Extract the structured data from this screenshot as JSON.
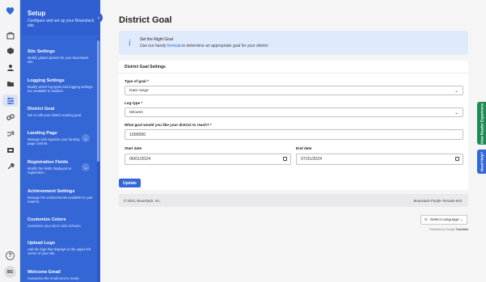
{
  "rail": {
    "logo": "heart-logo",
    "icons": [
      "library-icon",
      "box-icon",
      "user-icon",
      "folder-icon",
      "settings-icon",
      "link-icon",
      "shuffle-icon",
      "monitor-icon",
      "wrench-icon"
    ],
    "help": "?",
    "avatar": "BS"
  },
  "setup": {
    "title": "Setup",
    "description": "Configure and set up your Beanstack site.",
    "collapse": "‹",
    "items": [
      {
        "title": "Site Settings",
        "desc": "Modify global options for your Beanstack site."
      },
      {
        "title": "Logging Settings",
        "desc": "Modify which log types and logging settings are available to readers."
      },
      {
        "title": "District Goal",
        "desc": "Set or edit your district reading goal."
      },
      {
        "title": "Landing Page",
        "desc": "Manage and organize your landing page content."
      },
      {
        "title": "Registration Fields",
        "desc": "Modify the fields displayed at registration."
      },
      {
        "title": "Achievement Settings",
        "desc": "Manage the achievements available to your readers."
      },
      {
        "title": "Customize Colors",
        "desc": "Customize your site's color scheme."
      },
      {
        "title": "Upload Logo",
        "desc": "Add the logo that displays in the upper left corner of your site."
      },
      {
        "title": "Welcome Email",
        "desc": "Customize the email sent to newly"
      }
    ]
  },
  "main": {
    "title": "District Goal",
    "info": {
      "icon": "i",
      "title": "Set the Right Goal",
      "desc_before": "Use our handy ",
      "link": "formula",
      "desc_after": " to determine an appropriate goal for your district"
    },
    "card_title": "District Goal Settings",
    "goal_type_label": "Type of goal *",
    "goal_type_value": "Date range",
    "log_type_label": "Log type *",
    "log_type_value": "Minutes",
    "goal_label": "What goal would you like your district to reach? *",
    "goal_value": "1000000",
    "start_label": "Start date",
    "start_value": "06/01/2024",
    "end_label": "End date",
    "end_value": "07/31/2024",
    "update": "Update"
  },
  "footer": {
    "copyright": "© 2024, Beanstack, Inc.",
    "build": "Beanstack-Purple-Tornado-643"
  },
  "translate": {
    "g": "G",
    "label": "Select Language",
    "caret": "⌄",
    "powered_by": "Powered by",
    "google": "Google",
    "translate": "Translate"
  },
  "tabs": {
    "reader_experience": "View Reader Experience",
    "need_help": "Need Help?"
  },
  "colors": {
    "brand_blue": "#3466d6",
    "sidebar_blue": "#2f5fd0",
    "green_tab": "#1f8a55",
    "info_bg": "#dfeafd"
  }
}
